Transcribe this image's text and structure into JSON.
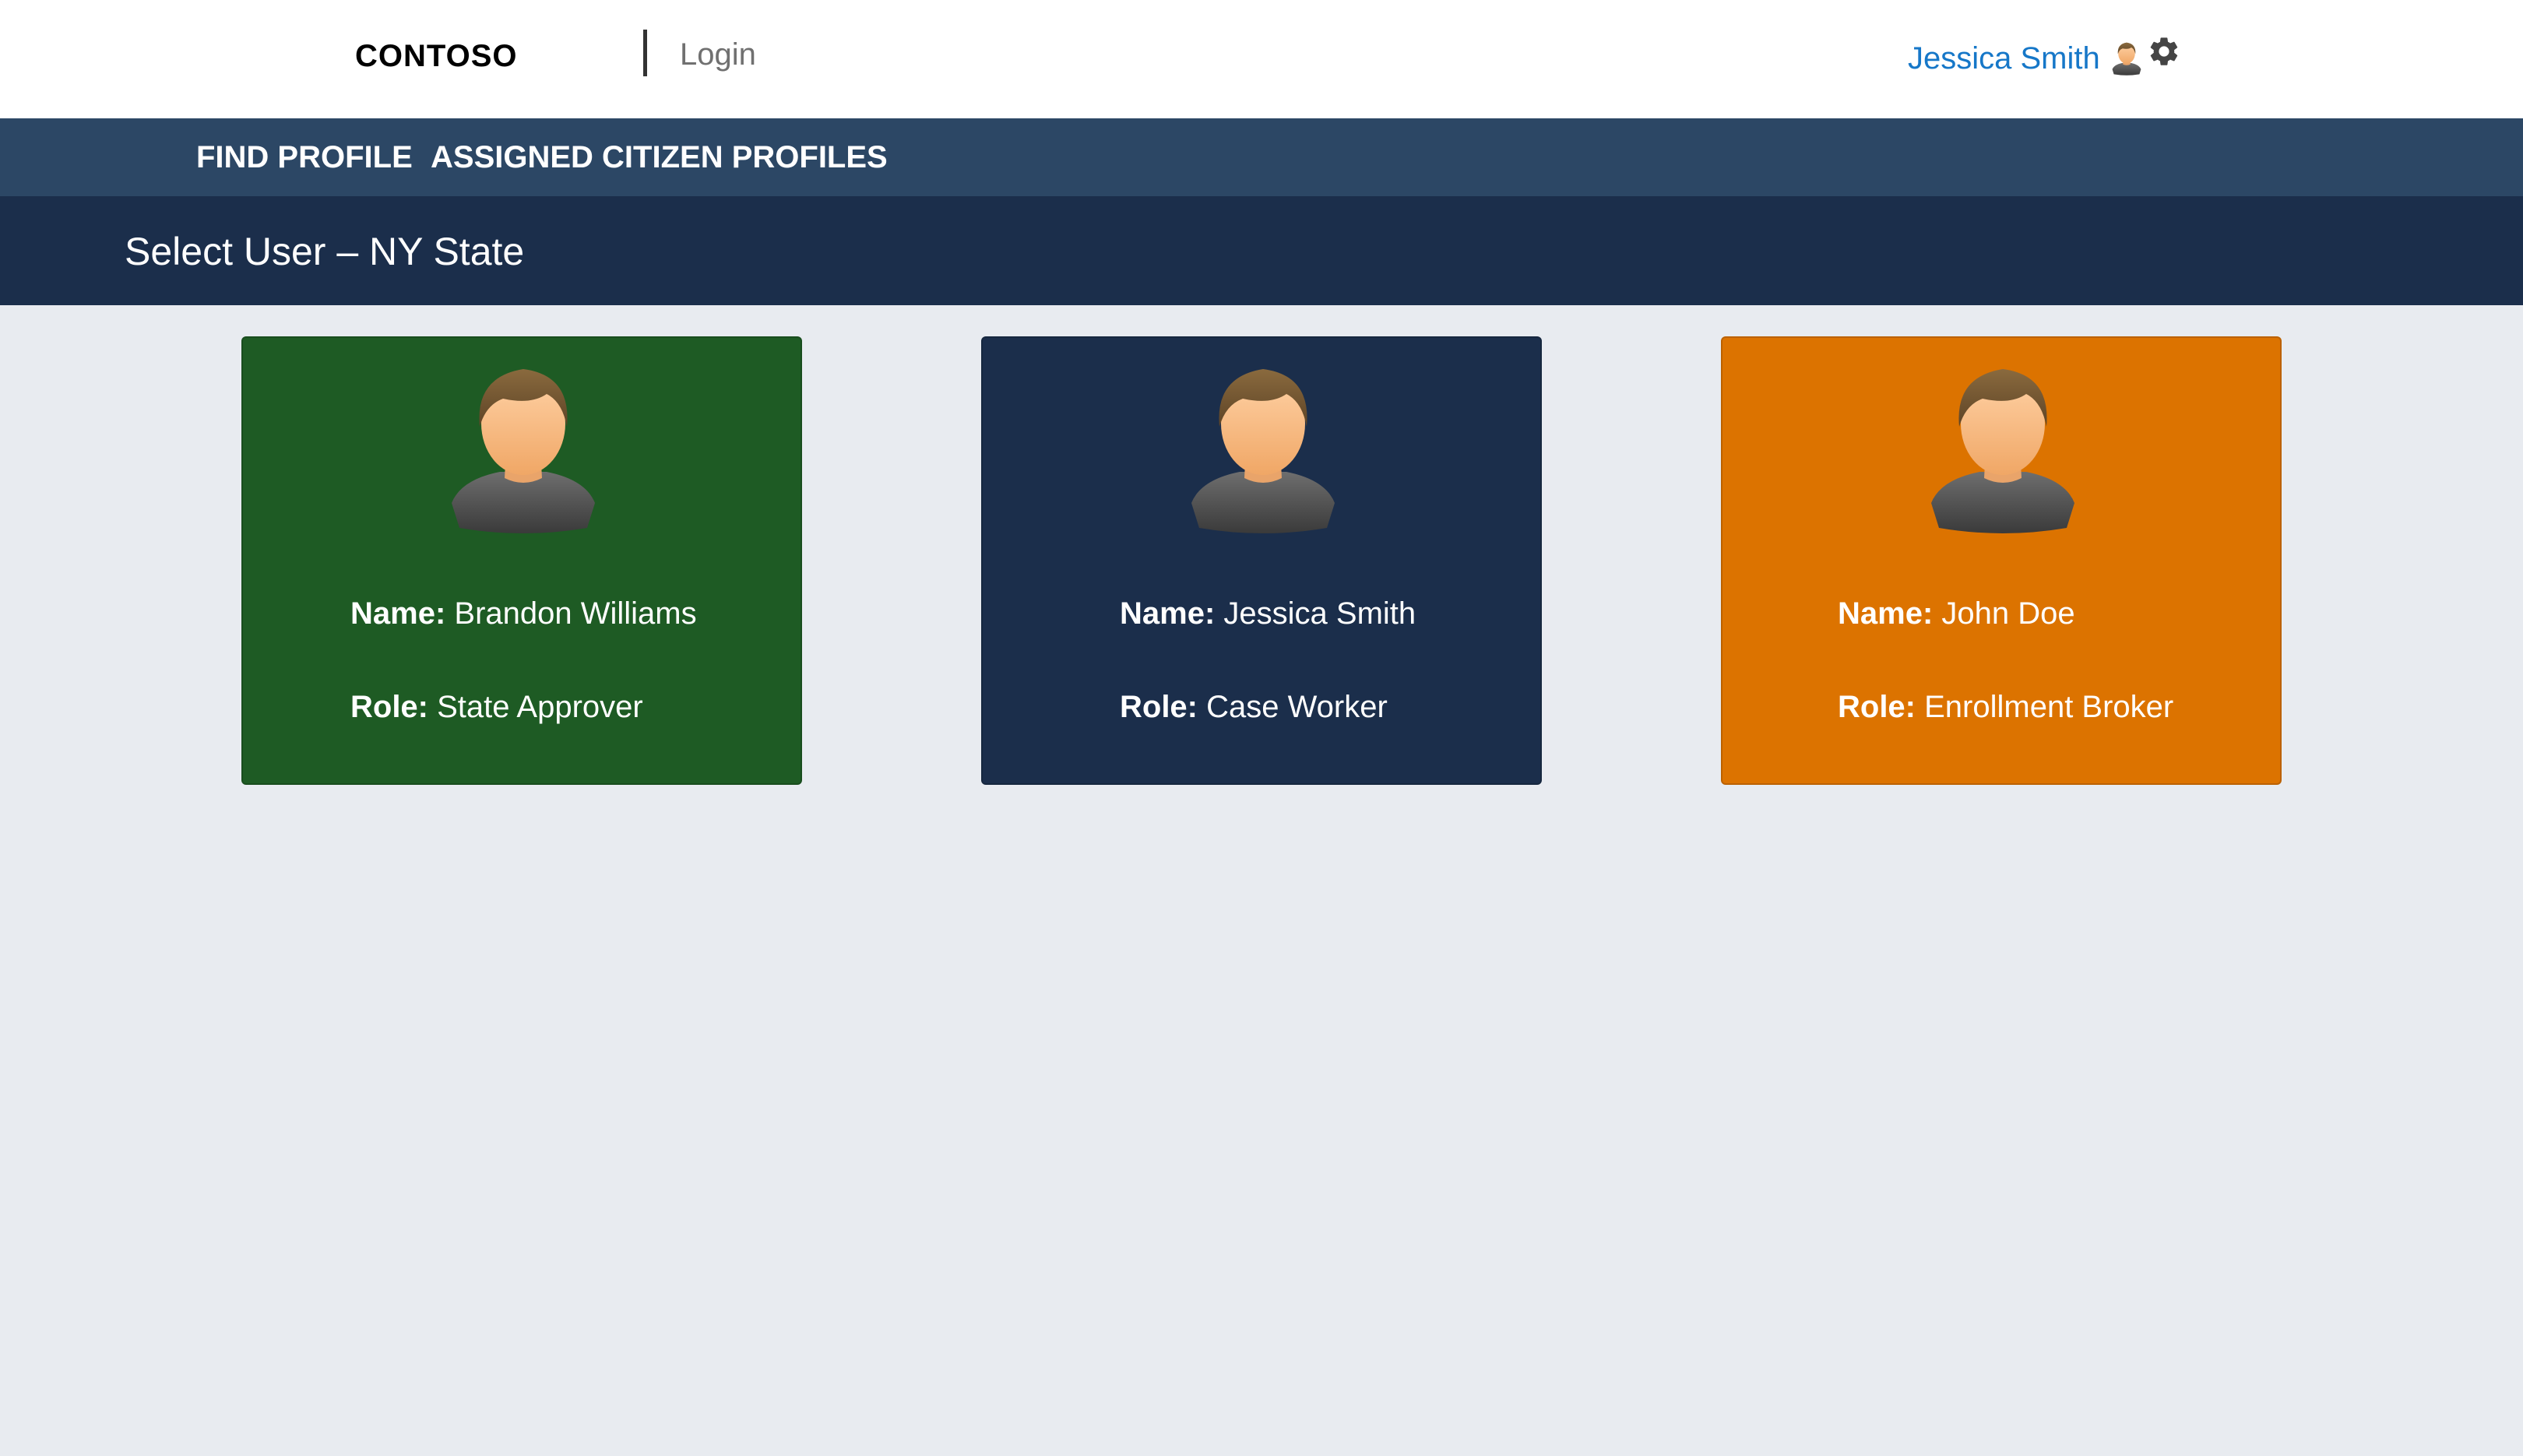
{
  "header": {
    "brand": "CONTOSO",
    "login_label": "Login",
    "user_name": "Jessica Smith",
    "user_icon": "user-avatar-icon",
    "settings_icon": "gear-icon"
  },
  "nav": {
    "items": [
      {
        "label": "FIND PROFILE"
      },
      {
        "label": "ASSIGNED CITIZEN PROFILES"
      }
    ]
  },
  "page": {
    "title": "Select User – NY State"
  },
  "cards": [
    {
      "name_label": "Name:",
      "name": "Brandon Williams",
      "role_label": "Role:",
      "role": "State Approver",
      "color": "#1e5b24"
    },
    {
      "name_label": "Name:",
      "name": "Jessica Smith",
      "role_label": "Role:",
      "role": "Case Worker",
      "color": "#1b2e4b"
    },
    {
      "name_label": "Name:",
      "name": "John Doe",
      "role_label": "Role:",
      "role": "Enrollment Broker",
      "color": "#dc7300"
    }
  ],
  "colors": {
    "header_bg": "#ffffff",
    "nav_bg": "#2c4765",
    "title_bar_bg": "#1b2e4b",
    "page_bg": "#e8ebf0",
    "link": "#1677c8"
  }
}
